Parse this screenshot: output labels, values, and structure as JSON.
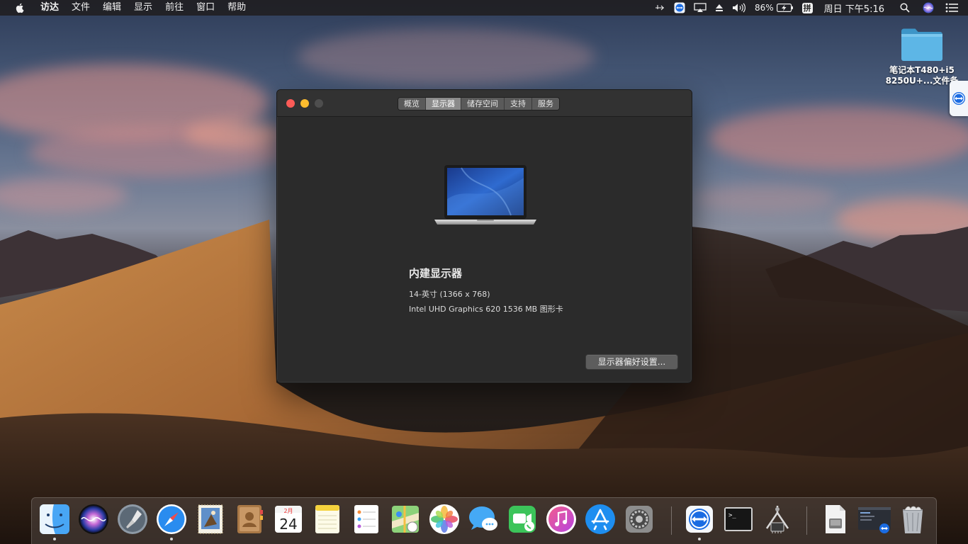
{
  "menubar": {
    "apple_icon": "apple-logo-icon",
    "items": [
      "访达",
      "文件",
      "编辑",
      "显示",
      "前往",
      "窗口",
      "帮助"
    ],
    "status": {
      "battery_percent": "86%",
      "ime": "拼",
      "clock": "周日 下午5:16"
    }
  },
  "desktop": {
    "icon_label_line1": "笔记本T480+i5",
    "icon_label_line2": "8250U+...文件备"
  },
  "window": {
    "tabs": [
      "概览",
      "显示器",
      "储存空间",
      "支持",
      "服务"
    ],
    "active_tab": "显示器",
    "display_title": "内建显示器",
    "display_size": "14-英寸 (1366 x 768)",
    "graphics": "Intel UHD Graphics 620 1536 MB 图形卡",
    "pref_button": "显示器偏好设置..."
  },
  "dock": {
    "items": [
      "finder-icon",
      "siri-icon",
      "launchpad-icon",
      "safari-icon",
      "mail-icon",
      "contacts-icon",
      "calendar-icon",
      "notes-icon",
      "reminders-icon",
      "maps-icon",
      "photos-icon",
      "messages-icon",
      "facetime-icon",
      "itunes-icon",
      "app-store-icon",
      "system-preferences-icon",
      "teamviewer-icon",
      "terminal-icon",
      "system-info-icon",
      "preview-document-icon",
      "screenshot-window-icon",
      "trash-icon"
    ],
    "calendar_month": "2月",
    "calendar_day": "24",
    "terminal_prompt": ">_"
  },
  "colors": {
    "close": "#fc5b57",
    "minimize": "#fdbc2e",
    "window_bg": "#2b2b2b",
    "active_tab": "#8a8a8a"
  }
}
